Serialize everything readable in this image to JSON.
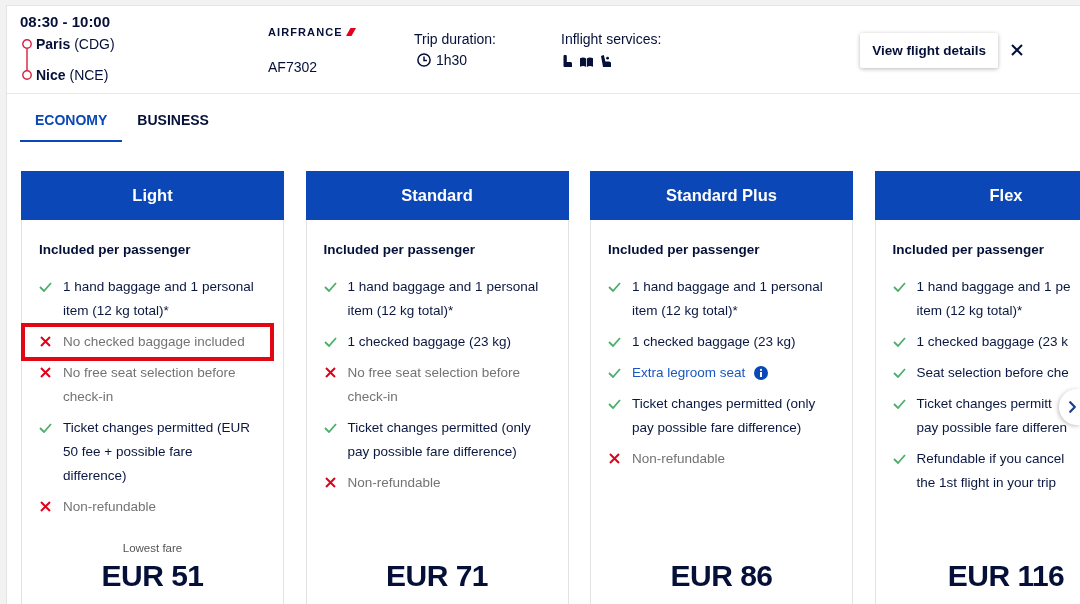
{
  "flight": {
    "time": "08:30 - 10:00",
    "stops": [
      {
        "text": "**Paris** (CDG)"
      },
      {
        "text": "**Nice** (NCE)"
      }
    ],
    "airline_logo": "AIRFRANCE",
    "flight_number": "AF7302",
    "duration_label": "Trip duration:",
    "duration": "1h30",
    "services_label": "Inflight services:",
    "details_button": "View flight details"
  },
  "tabs": [
    {
      "label": "ECONOMY",
      "selected": true
    },
    {
      "label": "BUSINESS",
      "selected": false
    }
  ],
  "fares": [
    {
      "name": "Light",
      "features_title": "Included per passenger",
      "features": [
        {
          "text": "1 hand baggage and 1 personal\nitem (12 kg total)*",
          "included": true,
          "highlighted": false,
          "kind": "plain"
        },
        {
          "text": "No checked baggage included",
          "included": false,
          "highlighted": true,
          "kind": "plain"
        },
        {
          "text": "No free seat selection before\ncheck-in",
          "included": false,
          "highlighted": false,
          "kind": "plain"
        },
        {
          "text": "Ticket changes permitted (EUR\n50 fee + possible fare\ndifference)",
          "included": true,
          "highlighted": false,
          "kind": "plain"
        },
        {
          "text": "Non-refundable",
          "included": false,
          "highlighted": false,
          "kind": "plain"
        }
      ],
      "price_label": "Lowest fare",
      "price": "EUR 51"
    },
    {
      "name": "Standard",
      "features_title": "Included per passenger",
      "features": [
        {
          "text": "1 hand baggage and 1 personal\nitem (12 kg total)*",
          "included": true,
          "highlighted": false,
          "kind": "plain"
        },
        {
          "text": "1 checked baggage (23 kg)",
          "included": true,
          "highlighted": false,
          "kind": "plain"
        },
        {
          "text": "No free seat selection before\ncheck-in",
          "included": false,
          "highlighted": false,
          "kind": "plain"
        },
        {
          "text": "Ticket changes permitted (only\npay possible fare difference)",
          "included": true,
          "highlighted": false,
          "kind": "plain"
        },
        {
          "text": "Non-refundable",
          "included": false,
          "highlighted": false,
          "kind": "plain"
        }
      ],
      "price": "EUR 71"
    },
    {
      "name": "Standard Plus",
      "features_title": "Included per passenger",
      "features": [
        {
          "text": "1 hand baggage and 1 personal\nitem (12 kg total)*",
          "included": true,
          "highlighted": false,
          "kind": "plain"
        },
        {
          "text": "1 checked baggage (23 kg)",
          "included": true,
          "highlighted": false,
          "kind": "plain"
        },
        {
          "text": "Extra legroom seat",
          "included": true,
          "highlighted": false,
          "kind": "link"
        },
        {
          "text": "Ticket changes permitted (only\npay possible fare difference)",
          "included": true,
          "highlighted": false,
          "kind": "plain"
        },
        {
          "text": "Non-refundable",
          "included": false,
          "highlighted": false,
          "kind": "plain"
        }
      ],
      "price": "EUR 86"
    },
    {
      "name": "Flex",
      "features_title": "Included per passenger",
      "features": [
        {
          "text": "1 hand baggage and 1 pe\nitem (12 kg total)*",
          "included": true,
          "highlighted": false,
          "kind": "plain"
        },
        {
          "text": "1 checked baggage (23 k",
          "included": true,
          "highlighted": false,
          "kind": "plain"
        },
        {
          "text": "Seat selection before che",
          "included": true,
          "highlighted": false,
          "kind": "plain"
        },
        {
          "text": "Ticket changes permitt\npay possible fare differen",
          "included": true,
          "highlighted": false,
          "kind": "plain"
        },
        {
          "text": "Refundable if you cancel\nthe 1st flight in your trip",
          "included": true,
          "highlighted": false,
          "kind": "plain"
        }
      ],
      "price": "EUR 116"
    }
  ]
}
